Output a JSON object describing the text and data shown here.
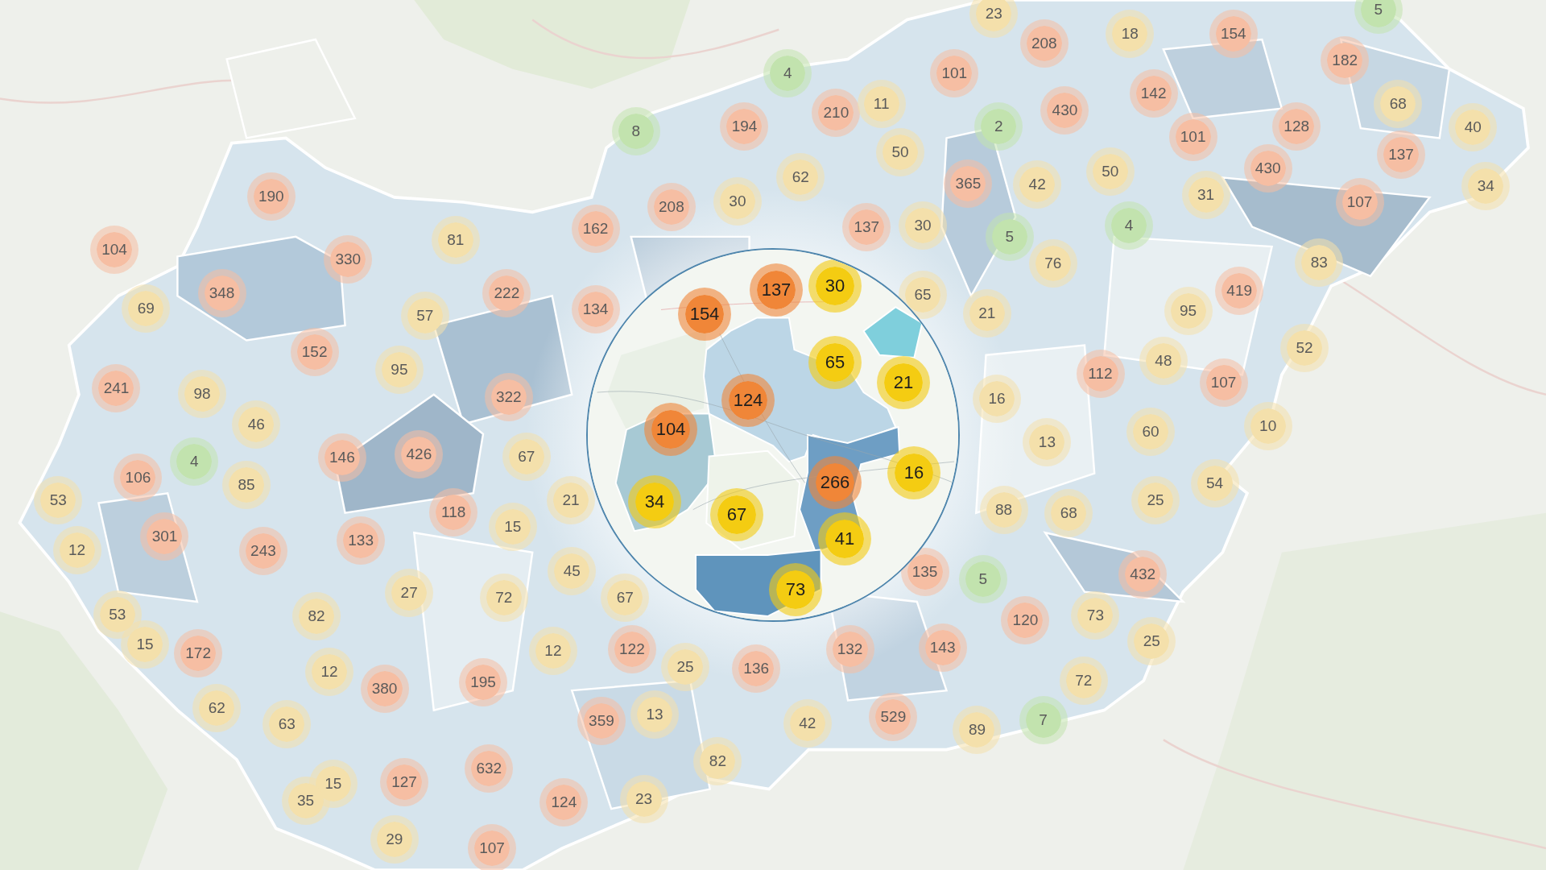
{
  "map": {
    "markers": [
      {
        "count": "23",
        "color": "#f4e0ab"
      },
      {
        "count": "5",
        "color": "#c2e3ae"
      },
      {
        "count": "18",
        "color": "#f4e0ab"
      },
      {
        "count": "154",
        "color": "#f6bea3"
      },
      {
        "count": "208",
        "color": "#f6bea3"
      },
      {
        "count": "182",
        "color": "#f6bea3"
      },
      {
        "count": "4",
        "color": "#c2e3ae"
      },
      {
        "count": "101",
        "color": "#f6bea3"
      },
      {
        "count": "142",
        "color": "#f6bea3"
      },
      {
        "count": "210",
        "color": "#f6bea3"
      },
      {
        "count": "11",
        "color": "#f4e0ab"
      },
      {
        "count": "430",
        "color": "#f6bea3"
      },
      {
        "count": "68",
        "color": "#f4e0ab"
      },
      {
        "count": "8",
        "color": "#c2e3ae"
      },
      {
        "count": "194",
        "color": "#f6bea3"
      },
      {
        "count": "2",
        "color": "#c2e3ae"
      },
      {
        "count": "101",
        "color": "#f6bea3"
      },
      {
        "count": "128",
        "color": "#f6bea3"
      },
      {
        "count": "40",
        "color": "#f4e0ab"
      },
      {
        "count": "50",
        "color": "#f4e0ab"
      },
      {
        "count": "137",
        "color": "#f6bea3"
      },
      {
        "count": "62",
        "color": "#f4e0ab"
      },
      {
        "count": "365",
        "color": "#f6bea3"
      },
      {
        "count": "42",
        "color": "#f4e0ab"
      },
      {
        "count": "50",
        "color": "#f4e0ab"
      },
      {
        "count": "430",
        "color": "#f6bea3"
      },
      {
        "count": "34",
        "color": "#f4e0ab"
      },
      {
        "count": "190",
        "color": "#f6bea3"
      },
      {
        "count": "208",
        "color": "#f6bea3"
      },
      {
        "count": "30",
        "color": "#f4e0ab"
      },
      {
        "count": "31",
        "color": "#f4e0ab"
      },
      {
        "count": "107",
        "color": "#f6bea3"
      },
      {
        "count": "81",
        "color": "#f4e0ab"
      },
      {
        "count": "162",
        "color": "#f6bea3"
      },
      {
        "count": "137",
        "color": "#f6bea3"
      },
      {
        "count": "30",
        "color": "#f4e0ab"
      },
      {
        "count": "5",
        "color": "#c2e3ae"
      },
      {
        "count": "4",
        "color": "#c2e3ae"
      },
      {
        "count": "104",
        "color": "#f6bea3"
      },
      {
        "count": "330",
        "color": "#f6bea3"
      },
      {
        "count": "76",
        "color": "#f4e0ab"
      },
      {
        "count": "83",
        "color": "#f4e0ab"
      },
      {
        "count": "348",
        "color": "#f6bea3"
      },
      {
        "count": "222",
        "color": "#f6bea3"
      },
      {
        "count": "65",
        "color": "#f4e0ab"
      },
      {
        "count": "419",
        "color": "#f6bea3"
      },
      {
        "count": "69",
        "color": "#f4e0ab"
      },
      {
        "count": "57",
        "color": "#f4e0ab"
      },
      {
        "count": "134",
        "color": "#f6bea3"
      },
      {
        "count": "21",
        "color": "#f4e0ab"
      },
      {
        "count": "95",
        "color": "#f4e0ab"
      },
      {
        "count": "152",
        "color": "#f6bea3"
      },
      {
        "count": "52",
        "color": "#f4e0ab"
      },
      {
        "count": "48",
        "color": "#f4e0ab"
      },
      {
        "count": "95",
        "color": "#f4e0ab"
      },
      {
        "count": "112",
        "color": "#f6bea3"
      },
      {
        "count": "241",
        "color": "#f6bea3"
      },
      {
        "count": "98",
        "color": "#f4e0ab"
      },
      {
        "count": "322",
        "color": "#f6bea3"
      },
      {
        "count": "16",
        "color": "#f4e0ab"
      },
      {
        "count": "107",
        "color": "#f6bea3"
      },
      {
        "count": "46",
        "color": "#f4e0ab"
      },
      {
        "count": "60",
        "color": "#f4e0ab"
      },
      {
        "count": "10",
        "color": "#f4e0ab"
      },
      {
        "count": "13",
        "color": "#f4e0ab"
      },
      {
        "count": "4",
        "color": "#c2e3ae"
      },
      {
        "count": "146",
        "color": "#f6bea3"
      },
      {
        "count": "426",
        "color": "#f6bea3"
      },
      {
        "count": "67",
        "color": "#f4e0ab"
      },
      {
        "count": "106",
        "color": "#f6bea3"
      },
      {
        "count": "85",
        "color": "#f4e0ab"
      },
      {
        "count": "54",
        "color": "#f4e0ab"
      },
      {
        "count": "53",
        "color": "#f4e0ab"
      },
      {
        "count": "21",
        "color": "#f4e0ab"
      },
      {
        "count": "25",
        "color": "#f4e0ab"
      },
      {
        "count": "118",
        "color": "#f6bea3"
      },
      {
        "count": "88",
        "color": "#f4e0ab"
      },
      {
        "count": "68",
        "color": "#f4e0ab"
      },
      {
        "count": "15",
        "color": "#f4e0ab"
      },
      {
        "count": "301",
        "color": "#f6bea3"
      },
      {
        "count": "133",
        "color": "#f6bea3"
      },
      {
        "count": "12",
        "color": "#f4e0ab"
      },
      {
        "count": "243",
        "color": "#f6bea3"
      },
      {
        "count": "45",
        "color": "#f4e0ab"
      },
      {
        "count": "135",
        "color": "#f6bea3"
      },
      {
        "count": "5",
        "color": "#c2e3ae"
      },
      {
        "count": "432",
        "color": "#f6bea3"
      },
      {
        "count": "27",
        "color": "#f4e0ab"
      },
      {
        "count": "72",
        "color": "#f4e0ab"
      },
      {
        "count": "67",
        "color": "#f4e0ab"
      },
      {
        "count": "53",
        "color": "#f4e0ab"
      },
      {
        "count": "82",
        "color": "#f4e0ab"
      },
      {
        "count": "120",
        "color": "#f6bea3"
      },
      {
        "count": "73",
        "color": "#f4e0ab"
      },
      {
        "count": "15",
        "color": "#f4e0ab"
      },
      {
        "count": "172",
        "color": "#f6bea3"
      },
      {
        "count": "12",
        "color": "#f4e0ab"
      },
      {
        "count": "122",
        "color": "#f6bea3"
      },
      {
        "count": "132",
        "color": "#f6bea3"
      },
      {
        "count": "143",
        "color": "#f6bea3"
      },
      {
        "count": "25",
        "color": "#f4e0ab"
      },
      {
        "count": "12",
        "color": "#f4e0ab"
      },
      {
        "count": "25",
        "color": "#f4e0ab"
      },
      {
        "count": "136",
        "color": "#f6bea3"
      },
      {
        "count": "380",
        "color": "#f6bea3"
      },
      {
        "count": "195",
        "color": "#f6bea3"
      },
      {
        "count": "72",
        "color": "#f4e0ab"
      },
      {
        "count": "62",
        "color": "#f4e0ab"
      },
      {
        "count": "63",
        "color": "#f4e0ab"
      },
      {
        "count": "359",
        "color": "#f6bea3"
      },
      {
        "count": "13",
        "color": "#f4e0ab"
      },
      {
        "count": "42",
        "color": "#f4e0ab"
      },
      {
        "count": "529",
        "color": "#f6bea3"
      },
      {
        "count": "89",
        "color": "#f4e0ab"
      },
      {
        "count": "7",
        "color": "#c2e3ae"
      },
      {
        "count": "632",
        "color": "#f6bea3"
      },
      {
        "count": "82",
        "color": "#f4e0ab"
      },
      {
        "count": "15",
        "color": "#f4e0ab"
      },
      {
        "count": "127",
        "color": "#f6bea3"
      },
      {
        "count": "35",
        "color": "#f4e0ab"
      },
      {
        "count": "124",
        "color": "#f6bea3"
      },
      {
        "count": "23",
        "color": "#f4e0ab"
      },
      {
        "count": "29",
        "color": "#f4e0ab"
      },
      {
        "count": "107",
        "color": "#f6bea3"
      }
    ]
  },
  "magnifier": {
    "markers": [
      {
        "count": "137",
        "color": "#f08638"
      },
      {
        "count": "30",
        "color": "#f4cc12"
      },
      {
        "count": "154",
        "color": "#f08638"
      },
      {
        "count": "65",
        "color": "#f4cc12"
      },
      {
        "count": "21",
        "color": "#f4cc12"
      },
      {
        "count": "124",
        "color": "#f08638"
      },
      {
        "count": "104",
        "color": "#f08638"
      },
      {
        "count": "16",
        "color": "#f4cc12"
      },
      {
        "count": "266",
        "color": "#f08638"
      },
      {
        "count": "34",
        "color": "#f4cc12"
      },
      {
        "count": "67",
        "color": "#f4cc12"
      },
      {
        "count": "41",
        "color": "#f4cc12"
      },
      {
        "count": "73",
        "color": "#f4cc12"
      }
    ]
  }
}
